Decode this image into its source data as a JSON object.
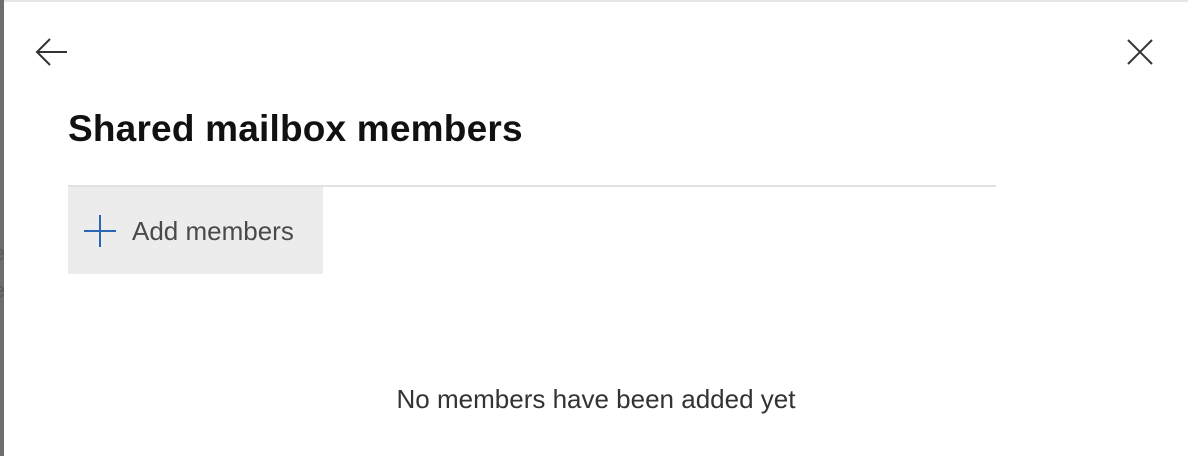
{
  "background": {
    "fragments": [
      "e",
      "e"
    ]
  },
  "panel": {
    "title": "Shared mailbox members",
    "back_icon": "arrow-left-icon",
    "close_icon": "close-icon",
    "add_members": {
      "icon": "plus-icon",
      "label": "Add members"
    },
    "empty_message": "No members have been added yet"
  },
  "colors": {
    "accent": "#2b66b5",
    "button_background": "#ececec",
    "divider": "#e1e1e1",
    "title_text": "#111111"
  }
}
